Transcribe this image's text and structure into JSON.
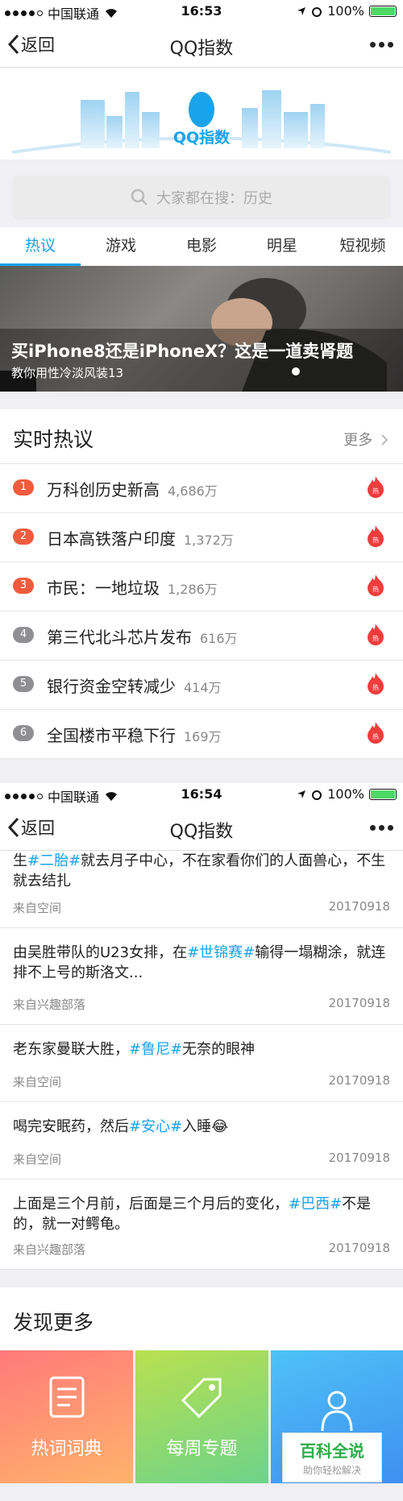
{
  "status_bar": {
    "carrier": "中国联通",
    "time_1": "16:53",
    "time_2": "16:54",
    "battery": "100%"
  },
  "nav": {
    "back_label": "返回",
    "title": "QQ指数"
  },
  "logo_text": "QQ指数",
  "search": {
    "placeholder": "大家都在搜：历史"
  },
  "tabs": [
    {
      "label": "热议",
      "active": true
    },
    {
      "label": "游戏",
      "active": false
    },
    {
      "label": "电影",
      "active": false
    },
    {
      "label": "明星",
      "active": false
    },
    {
      "label": "短视频",
      "active": false
    }
  ],
  "hero": {
    "title": "买iPhone8还是iPhoneX？这是一道卖肾题",
    "subtitle": "教你用性冷淡风装13"
  },
  "hot_section": {
    "title": "实时热议",
    "more_label": "更多"
  },
  "hot_list": [
    {
      "rank": "1",
      "topic": "万科创历史新高",
      "count": "4,686万",
      "rank_color": "#f25b3d"
    },
    {
      "rank": "2",
      "topic": "日本高铁落户印度",
      "count": "1,372万",
      "rank_color": "#f25b3d"
    },
    {
      "rank": "3",
      "topic": "市民：一地垃圾",
      "count": "1,286万",
      "rank_color": "#f25b3d"
    },
    {
      "rank": "4",
      "topic": "第三代北斗芯片发布",
      "count": "616万",
      "rank_color": "#8e8e93"
    },
    {
      "rank": "5",
      "topic": "银行资金空转减少",
      "count": "414万",
      "rank_color": "#8e8e93"
    },
    {
      "rank": "6",
      "topic": "全国楼市平稳下行",
      "count": "169万",
      "rank_color": "#8e8e93"
    }
  ],
  "feed": [
    {
      "parts": [
        "生",
        "#二胎#",
        "就去月子中心，不在家看你们的人面兽心，不生就去结扎"
      ],
      "source": "来自空间",
      "date": "20170918"
    },
    {
      "parts": [
        "由吴胜带队的U23女排，在",
        "#世锦赛#",
        "输得一塌糊涂，就连排不上号的斯洛文..."
      ],
      "source": "来自兴趣部落",
      "date": "20170918"
    },
    {
      "parts": [
        "老东家曼联大胜，",
        "#鲁尼#",
        "无奈的眼神"
      ],
      "source": "来自空间",
      "date": "20170918"
    },
    {
      "parts": [
        "喝完安眠药，然后",
        "#安心#",
        "入睡😂"
      ],
      "source": "来自空间",
      "date": "20170918"
    },
    {
      "parts": [
        "上面是三个月前，后面是三个月后的变化，",
        "#巴西#",
        "不是的，就一对鳄龟。"
      ],
      "source": "来自兴趣部落",
      "date": "20170918"
    }
  ],
  "discover": {
    "title": "发现更多",
    "tiles": [
      {
        "label": "热词词典",
        "icon": "book-icon"
      },
      {
        "label": "每周专题",
        "icon": "tag-icon"
      },
      {
        "label": "",
        "icon": "person-icon"
      }
    ]
  },
  "watermark": {
    "main": "百科全说",
    "sub": "助你轻松解决"
  },
  "colors": {
    "accent": "#1aa3ea",
    "hot_rank": "#f25b3d",
    "cold_rank": "#8e8e93"
  }
}
